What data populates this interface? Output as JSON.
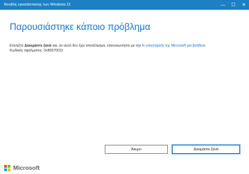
{
  "window": {
    "title": "Βοηθός εγκατάστασης των Windows 11",
    "minimize_glyph": "—",
    "maximize_glyph": "☐",
    "close_glyph": "✕"
  },
  "main": {
    "heading": "Παρουσιάστηκε κάποιο πρόβλημα",
    "message_prefix": "Επιλέξτε",
    "message_bold": "Δοκιμάστε ξανά",
    "message_middle": "και, αν αυτό δεν έχει αποτέλεσμα, επικοινωνήστε με την",
    "message_link": "Η υποστήριξη της Microsoft για βοήθεια.",
    "error_code": "Κωδικός σφάλματος: 0x8007001f"
  },
  "buttons": {
    "cancel_label": "Άκυρο",
    "retry_label": "Δοκιμάστε ξανά"
  },
  "footer": {
    "brand": "Microsoft",
    "logo_colors": [
      "#f25022",
      "#7fba00",
      "#00a4ef",
      "#ffb900"
    ]
  },
  "colors": {
    "titlebar": "#1d7fc4",
    "accent": "#1a73c6"
  }
}
